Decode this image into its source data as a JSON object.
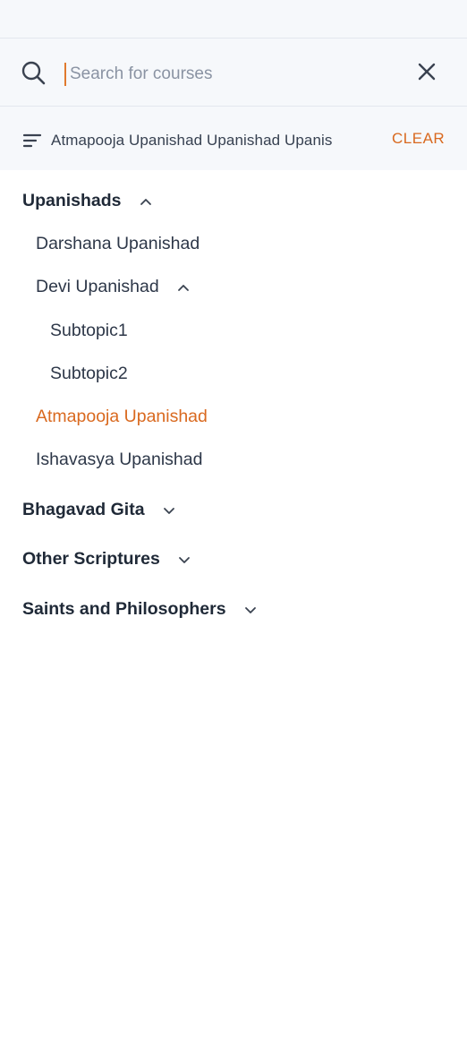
{
  "search": {
    "placeholder": "Search for courses",
    "value": ""
  },
  "filter": {
    "text": "Atmapooja Upanishad Upanishad Upanis",
    "clear_label": "CLEAR"
  },
  "colors": {
    "accent": "#d9691f",
    "panel_bg": "#f6f8fb",
    "text": "#1f2937"
  },
  "tree": {
    "upanishads": {
      "label": "Upanishads",
      "expanded": true,
      "children": {
        "darshana": {
          "label": "Darshana Upanishad"
        },
        "devi": {
          "label": "Devi Upanishad",
          "expanded": true,
          "children": {
            "subtopic1": {
              "label": "Subtopic1"
            },
            "subtopic2": {
              "label": "Subtopic2"
            }
          }
        },
        "atmapooja": {
          "label": "Atmapooja Upanishad",
          "selected": true
        },
        "ishavasya": {
          "label": "Ishavasya Upanishad"
        }
      }
    },
    "bhagavad_gita": {
      "label": "Bhagavad Gita",
      "expanded": false
    },
    "other_scriptures": {
      "label": "Other Scriptures",
      "expanded": false
    },
    "saints": {
      "label": "Saints and Philosophers",
      "expanded": false
    }
  }
}
